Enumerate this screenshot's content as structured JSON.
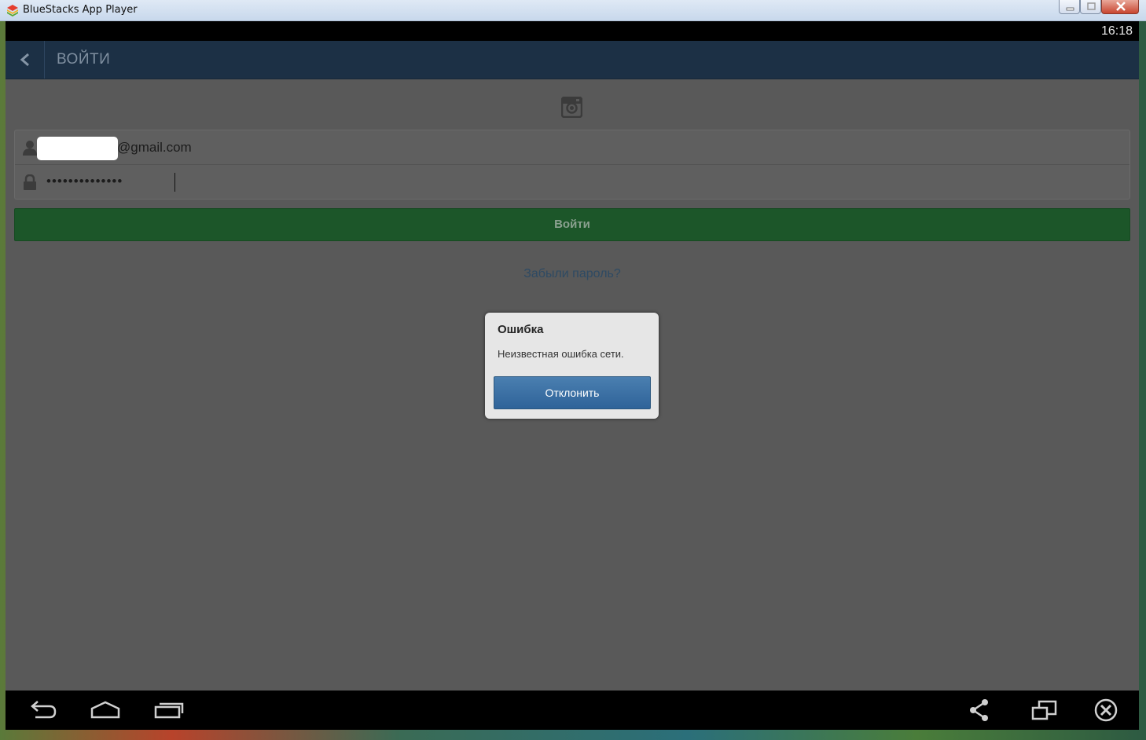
{
  "window": {
    "title": "BlueStacks App Player"
  },
  "status_bar": {
    "time": "16:18"
  },
  "action_bar": {
    "title": "ВОЙТИ"
  },
  "login_form": {
    "email_suffix": "@gmail.com",
    "password_masked": "••••••••••••••",
    "login_button": "Войти",
    "forgot_password": "Забыли пароль?"
  },
  "dialog": {
    "title": "Ошибка",
    "message": "Неизвестная ошибка сети.",
    "dismiss_button": "Отклонить"
  },
  "colors": {
    "action_bar": "#1c3045",
    "login_button": "#1c5629",
    "dialog_button": "#3a6ea3"
  }
}
